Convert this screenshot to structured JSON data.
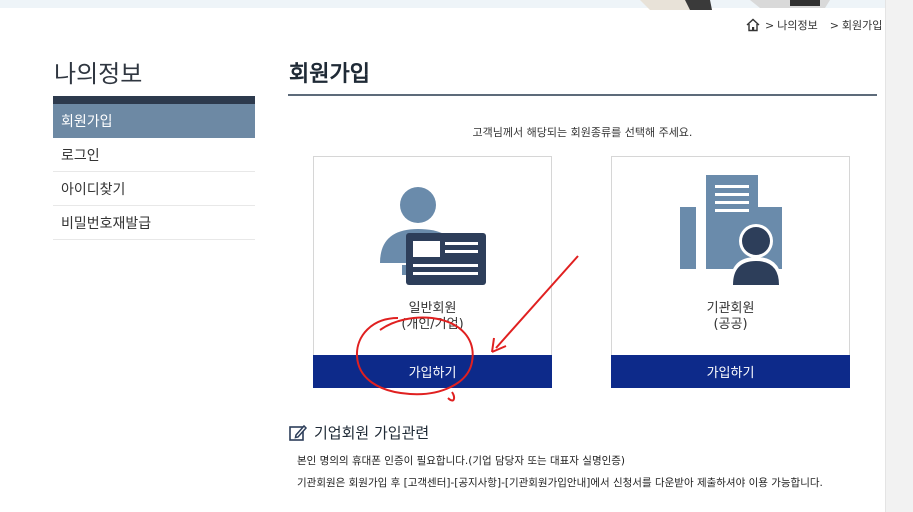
{
  "breadcrumb": {
    "home_icon": "home-icon",
    "sep1": ">",
    "item1": "나의정보",
    "sep2": ">",
    "item2": "회원가입"
  },
  "sidebar": {
    "title": "나의정보",
    "items": [
      {
        "label": "회원가입",
        "active": true
      },
      {
        "label": "로그인",
        "active": false
      },
      {
        "label": "아이디찾기",
        "active": false
      },
      {
        "label": "비밀번호재발급",
        "active": false
      }
    ]
  },
  "main": {
    "title": "회원가입",
    "instruction": "고객님께서 해당되는 회원종류를 선택해 주세요.",
    "cards": [
      {
        "line1": "일반회원",
        "line2": "(개인/기업)",
        "button": "가입하기",
        "icon": "person-id-card-icon"
      },
      {
        "line1": "기관회원",
        "line2": "(공공)",
        "button": "가입하기",
        "icon": "building-person-icon"
      }
    ]
  },
  "corporate": {
    "icon": "edit-icon",
    "title": "기업회원 가입관련",
    "line1": "본인 명의의 휴대폰 인증이 필요합니다.(기업 담당자 또는 대표자 실명인증)",
    "line2": "기관회원은 회원가입 후 [고객센터]-[공지사항]-[기관회원가입안내]에서 신청서를 다운받아 제출하셔야 이용 가능합니다."
  },
  "colors": {
    "accent_navy": "#0d2a8a",
    "sidebar_active": "#6d89a4",
    "icon_steel": "#6a8bab",
    "icon_dark": "#2d3e5a",
    "annotation_red": "#e02020"
  }
}
